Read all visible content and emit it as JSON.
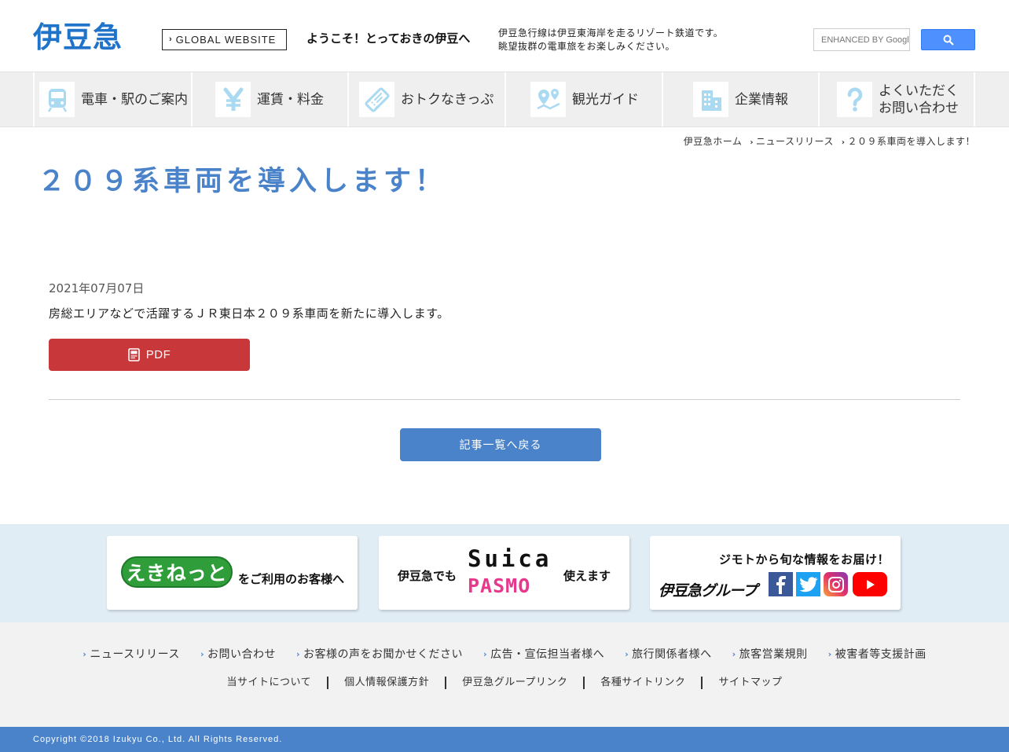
{
  "header": {
    "logo_text": "伊豆急",
    "global_label": "GLOBAL WEBSITE",
    "welcome": "ようこそ！とっておきの伊豆へ",
    "intro_line1": "伊豆急行線は伊豆東海岸を走るリゾート鉄道です。",
    "intro_line2": "眺望抜群の電車旅をお楽しみください。",
    "search_placeholder": "ENHANCED BY Google"
  },
  "nav": {
    "items": [
      {
        "label": "電車・駅のご案内",
        "icon": "train-icon"
      },
      {
        "label": "運賃・料金",
        "icon": "yen-icon"
      },
      {
        "label": "おトクなきっぷ",
        "icon": "ticket-icon"
      },
      {
        "label": "観光ガイド",
        "icon": "map-pin-icon"
      },
      {
        "label": "企業情報",
        "icon": "building-icon"
      },
      {
        "label_line1": "よくいただく",
        "label_line2": "お問い合わせ",
        "icon": "question-icon"
      }
    ]
  },
  "breadcrumb": {
    "home": "伊豆急ホーム",
    "news": "ニュースリリース",
    "current": "２０９系車両を導入します！"
  },
  "article": {
    "title": "２０９系車両を導入します！",
    "date": "2021年07月07日",
    "body": "房総エリアなどで活躍するＪＲ東日本２０９系車両を新たに導入します。",
    "pdf_label": "PDF",
    "back_label": "記事一覧へ戻る"
  },
  "banners": {
    "ekinet_logo": "えきねっと",
    "ekinet_text": "をご利用のお客様へ",
    "suica_pre": "伊豆急でも",
    "suica_word": "Suica",
    "pasmo_word": "PASMO",
    "suica_post": "使えます",
    "social_headline": "ジモトから旬な情報をお届け！",
    "group_logo": "伊豆急グループ"
  },
  "footer": {
    "row1": [
      "ニュースリリース",
      "お問い合わせ",
      "お客様の声をお聞かせください",
      "広告・宣伝担当者様へ",
      "旅行関係者様へ",
      "旅客営業規則",
      "被害者等支援計画"
    ],
    "row2": [
      "当サイトについて",
      "個人情報保護方針",
      "伊豆急グループリンク",
      "各種サイトリンク",
      "サイトマップ"
    ],
    "copyright": "Copyright ©2018 Izukyu Co., Ltd. All Rights Reserved."
  },
  "colors": {
    "brand_blue": "#1f73c9",
    "accent_blue": "#4a83c9",
    "pdf_red": "#c8383a",
    "icon_light_blue": "#a9daf2"
  }
}
